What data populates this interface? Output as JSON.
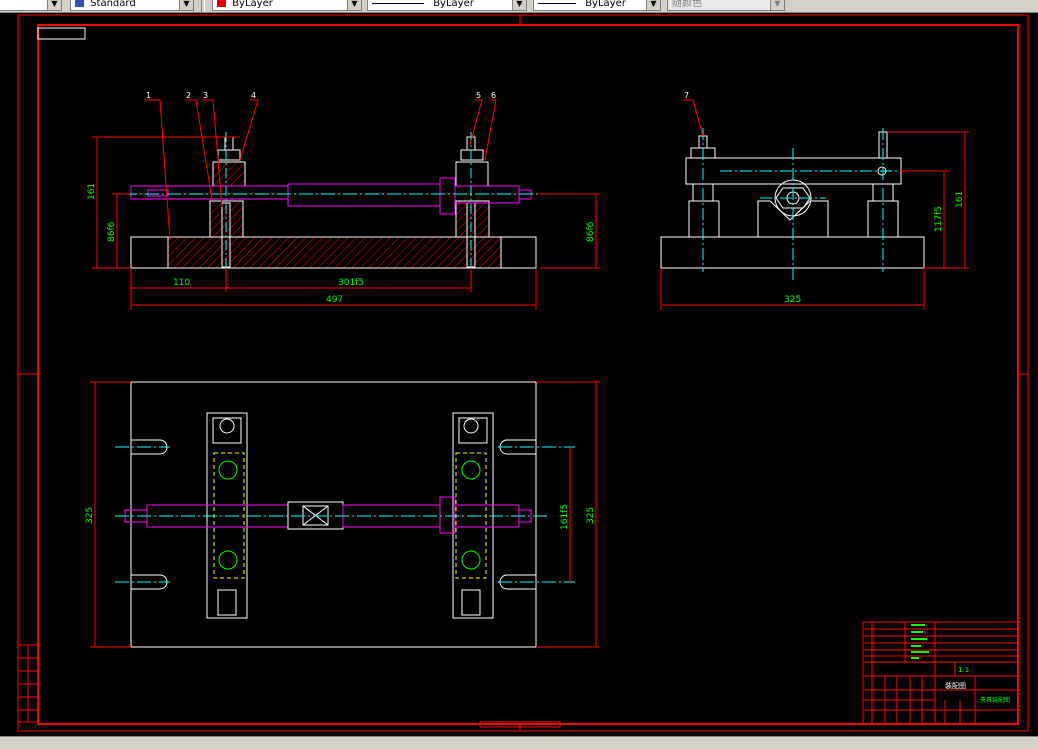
{
  "toolbar": {
    "text_style": "Standard",
    "layer_color": "ByLayer",
    "linetype": "ByLayer",
    "lineweight": "ByLayer",
    "plot_style": "随颜色"
  },
  "views": {
    "front": {
      "balloons": [
        "1",
        "2",
        "3",
        "4",
        "5",
        "6"
      ],
      "dims": {
        "overall_height": "161",
        "left_height": "86f6",
        "right_height": "86f6",
        "left_offset": "110",
        "center_distance": "301f5",
        "overall_length": "497"
      }
    },
    "side": {
      "balloons": [
        "7"
      ],
      "dims": {
        "shaft_height": "117f5",
        "overall_height": "161",
        "width": "325"
      }
    },
    "top": {
      "dims": {
        "left_width": "325",
        "right_width": "325",
        "hole_spacing": "161f5"
      }
    }
  },
  "title_block": {
    "part_name": "装配图",
    "scale": "1:1",
    "drawing_label": "夹具装配图"
  },
  "colors": {
    "frame": "#ff0000",
    "outline": "#ffffff",
    "dimension": "#ff0000",
    "dimension_text": "#00ff00",
    "shaft": "#ff00ff",
    "centerline": "#00ffff",
    "hatch": "#ff0000",
    "tb_green": "#00ff00"
  }
}
